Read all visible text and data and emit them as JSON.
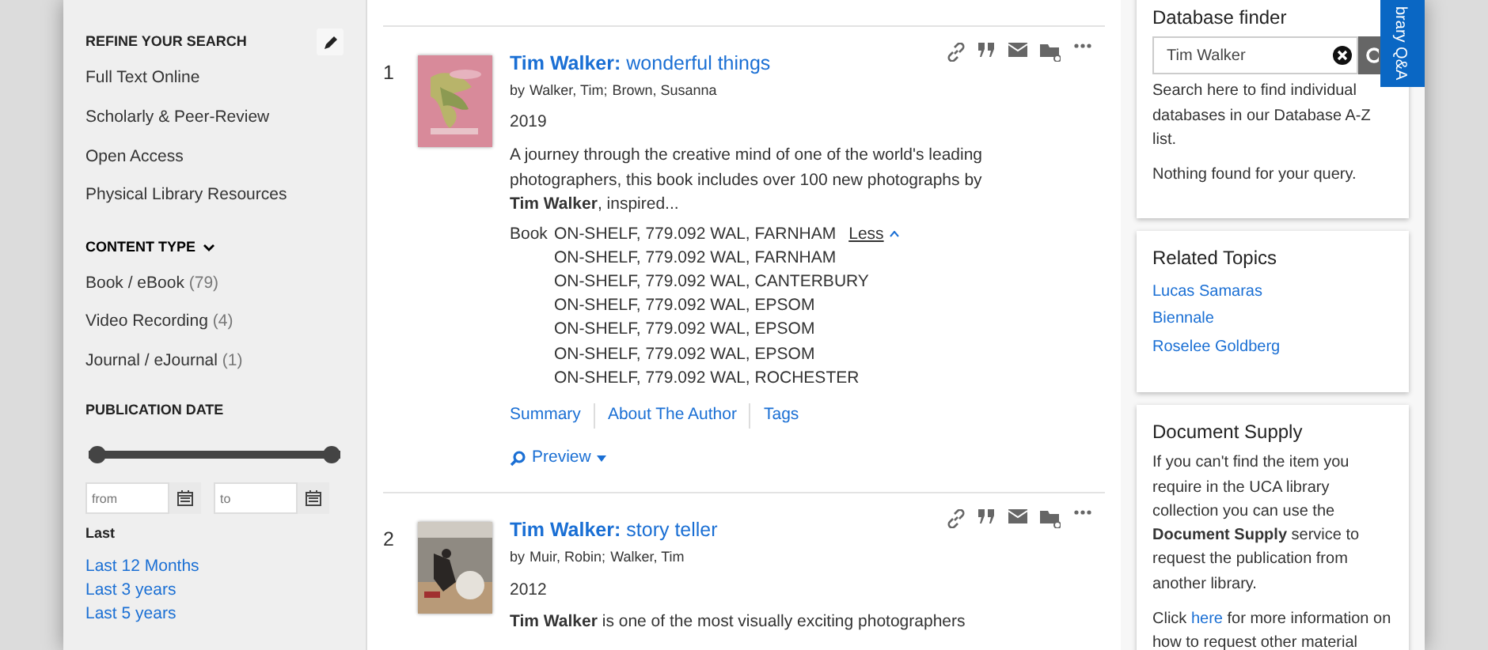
{
  "sidebar": {
    "refine": {
      "title": "REFINE YOUR SEARCH",
      "items": [
        "Full Text Online",
        "Scholarly & Peer-Review",
        "Open Access",
        "Physical Library Resources"
      ]
    },
    "content_type": {
      "title": "CONTENT TYPE",
      "expanded": true,
      "items": [
        {
          "label": "Book / eBook",
          "count": "(79)"
        },
        {
          "label": "Video Recording",
          "count": "(4)"
        },
        {
          "label": "Journal / eJournal",
          "count": "(1)"
        }
      ]
    },
    "publication_date": {
      "title": "PUBLICATION DATE",
      "slider": {
        "low": {
          "level": 0
        },
        "high": {
          "level": 1
        }
      },
      "from": {
        "placeholder": "from"
      },
      "to": {
        "placeholder": "to"
      },
      "last_label": "Last",
      "last_links": [
        "Last 12 Months",
        "Last 3 years",
        "Last 5 years"
      ]
    }
  },
  "results": [
    {
      "number": "1",
      "title": "**Tim Walker:** wonderful things",
      "by": "by",
      "authors": [
        "Walker, Tim",
        "Brown, Susanna"
      ],
      "separator": ";",
      "year": "2019",
      "snippet": "A journey through the creative mind of one of the world's leading photographers, this book includes over 100 new photographs by **Tim Walker**, inspired...",
      "format": "Book",
      "holdings": [
        "ON-SHELF, 779.092 WAL, FARNHAM",
        "ON-SHELF, 779.092 WAL, FARNHAM",
        "ON-SHELF, 779.092 WAL, CANTERBURY",
        "ON-SHELF, 779.092 WAL, EPSOM",
        "ON-SHELF, 779.092 WAL, EPSOM",
        "ON-SHELF, 779.092 WAL, EPSOM",
        "ON-SHELF, 779.092 WAL, ROCHESTER"
      ],
      "toggle": "Less",
      "tabs": [
        "Summary",
        "About The Author",
        "Tags"
      ],
      "preview": "Preview"
    },
    {
      "number": "2",
      "title": "**Tim Walker:** story teller",
      "by": "by",
      "authors": [
        "Muir, Robin",
        "Walker, Tim"
      ],
      "separator": ";",
      "year": "2012",
      "snippet": "**Tim Walker** is one of the most visually exciting photographers"
    }
  ],
  "right": {
    "database_finder": {
      "title": "Database finder",
      "query": "Tim Walker",
      "help": "Search here to find individual databases in our Database A-Z list.",
      "message": "Nothing found for your query."
    },
    "related_topics": {
      "title": "Related Topics",
      "links": [
        "Lucas Samaras",
        "Biennale",
        "Roselee Goldberg"
      ]
    },
    "document_supply": {
      "title": "Document Supply",
      "text": "If you can't find the item you require in the UCA library collection you can use the **Document Supply** service to request the publication from another library.",
      "click_before": "Click",
      "click_link": "here",
      "click_after": "for more information on how to request other material"
    }
  },
  "qa_tab": "brary Q&A"
}
